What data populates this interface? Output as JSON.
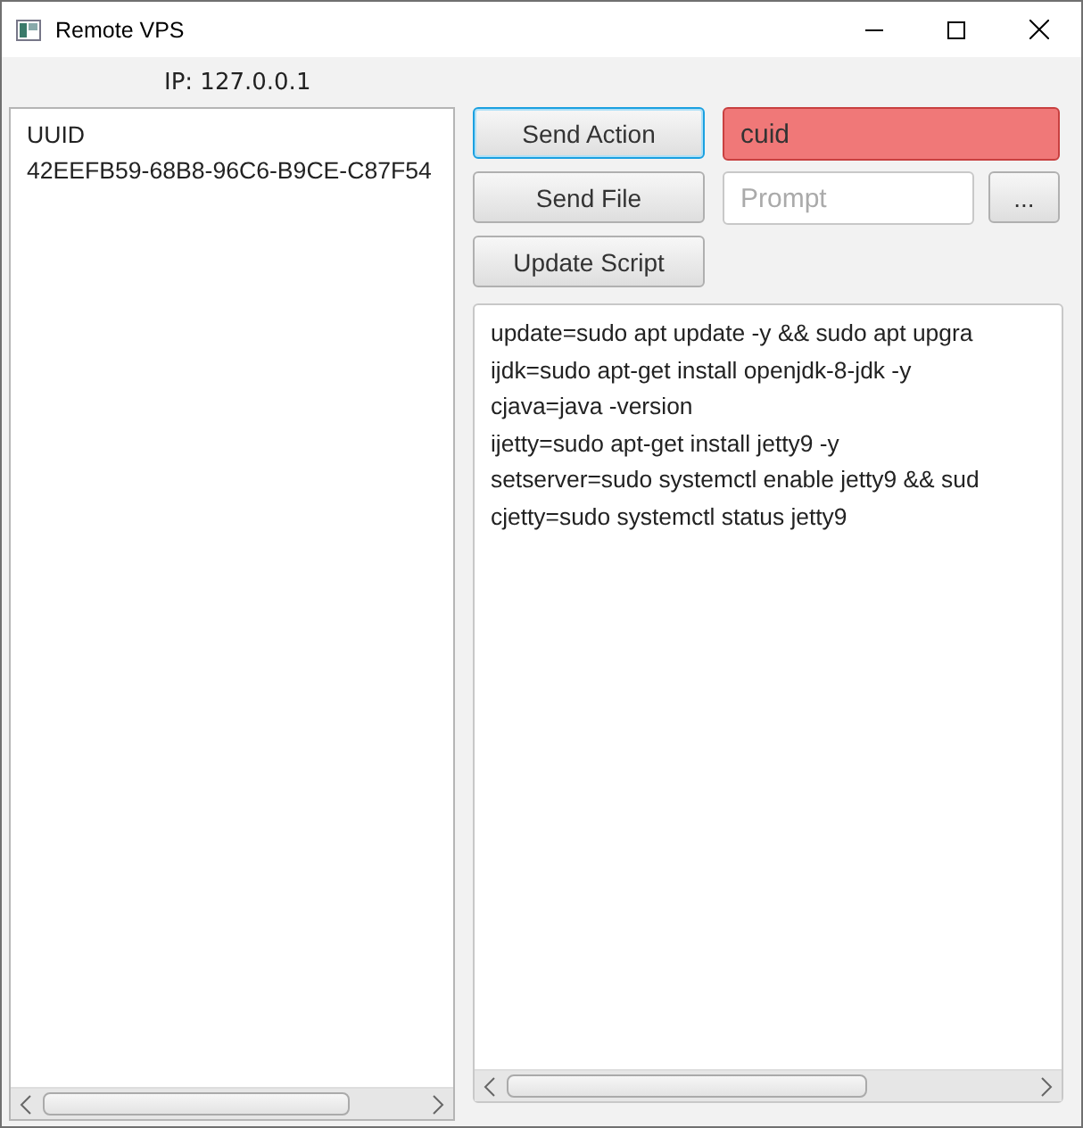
{
  "window": {
    "title": "Remote VPS"
  },
  "ip_label": "IP: 127.0.0.1",
  "device_list": {
    "items": [
      {
        "text": "UUID"
      },
      {
        "text": "42EEFB59-68B8-96C6-B9CE-C87F54"
      }
    ]
  },
  "buttons": [
    {
      "label": "Send Action",
      "focused": true
    },
    {
      "label": "Send File",
      "focused": false
    },
    {
      "label": "Update Script",
      "focused": false
    }
  ],
  "action_field": {
    "value": "cuid",
    "invalid": true
  },
  "prompt_field": {
    "placeholder": "Prompt",
    "invalid": false
  },
  "browse_button": {
    "label": "..."
  },
  "script_lines": [
    "update=sudo apt update -y && sudo apt upgra",
    "ijdk=sudo apt-get install openjdk-8-jdk -y",
    "cjava=java -version",
    "ijetty=sudo apt-get install jetty9 -y",
    "setserver=sudo systemctl enable jetty9 && sud",
    "cjetty=sudo systemctl status jetty9"
  ]
}
